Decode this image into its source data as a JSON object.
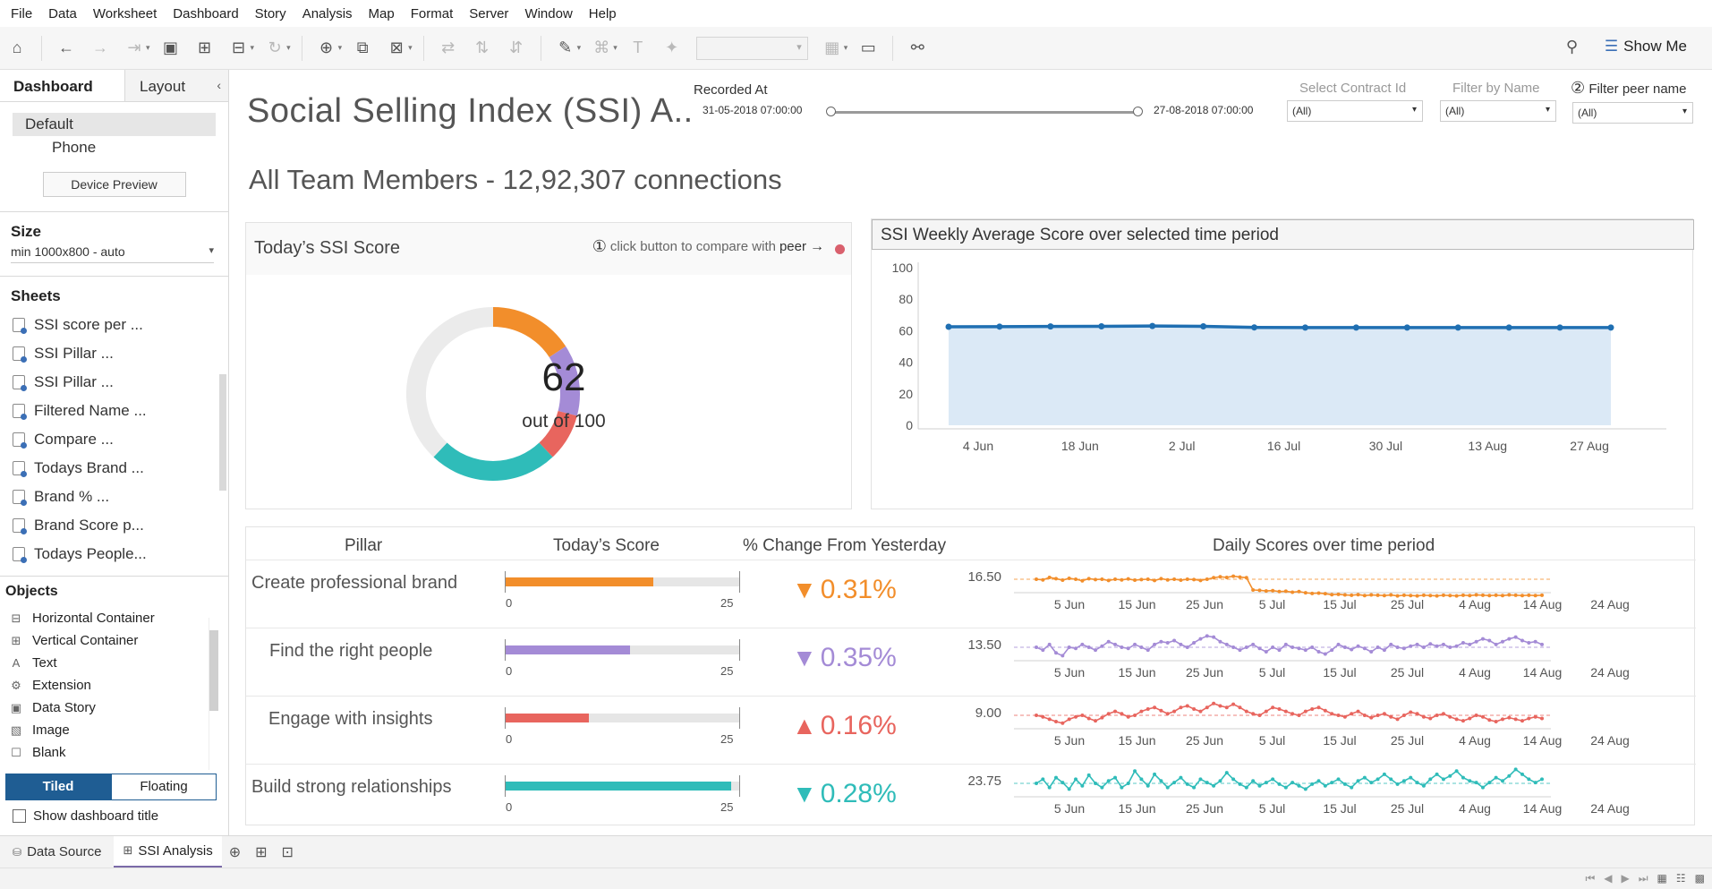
{
  "menu": [
    "File",
    "Data",
    "Worksheet",
    "Dashboard",
    "Story",
    "Analysis",
    "Map",
    "Format",
    "Server",
    "Window",
    "Help"
  ],
  "toolbar": {
    "show_me": "Show Me"
  },
  "left_panel": {
    "tab_dashboard": "Dashboard",
    "tab_layout": "Layout",
    "devices": [
      "Default",
      "Phone"
    ],
    "device_preview": "Device Preview",
    "size_title": "Size",
    "size_value": "min 1000x800 - auto",
    "sheets_title": "Sheets",
    "sheets": [
      "SSI score per ...",
      "SSI Pillar ...",
      "SSI Pillar ...",
      "Filtered Name ...",
      "Compare ...",
      "Todays Brand ...",
      "Brand % ...",
      "Brand Score p...",
      "Todays People..."
    ],
    "objects_title": "Objects",
    "objects": [
      {
        "label": "Horizontal Container",
        "icon": "horizontal-container-icon"
      },
      {
        "label": "Vertical Container",
        "icon": "vertical-container-icon"
      },
      {
        "label": "Text",
        "icon": "text-icon"
      },
      {
        "label": "Extension",
        "icon": "extension-icon"
      },
      {
        "label": "Data Story",
        "icon": "data-story-icon"
      },
      {
        "label": "Image",
        "icon": "image-icon"
      },
      {
        "label": "Blank",
        "icon": "blank-icon"
      }
    ],
    "tiled": "Tiled",
    "floating": "Floating",
    "show_dashboard_title": "Show dashboard title"
  },
  "dashboard": {
    "title": "Social Selling Index (SSI) A..",
    "subtitle": "All Team Members - 12,92,307 connections",
    "recorded_at": {
      "label": "Recorded At",
      "start": "31-05-2018 07:00:00",
      "end": "27-08-2018 07:00:00"
    },
    "filters": [
      {
        "label": "Select Contract Id",
        "value": "(All)"
      },
      {
        "label": "Filter by Name",
        "value": "(All)"
      },
      {
        "label": "Filter peer name",
        "value": "(All)",
        "marker": "②"
      }
    ],
    "ssi_card": {
      "title": "Today’s SSI Score",
      "compare_marker": "①",
      "compare_text": "click button to compare with",
      "compare_bold": "peer",
      "score": "62",
      "score_sub": "out of 100"
    },
    "weekly_title": "SSI Weekly Average Score over selected time period",
    "pillar_headers": {
      "pillar": "Pillar",
      "today": "Today’s Score",
      "change": "% Change From Yesterday",
      "daily": "Daily Scores over time period"
    },
    "pillars": [
      {
        "name": "Create professional brand",
        "value": 15.8,
        "max": 25,
        "change": "0.31%",
        "direction": "down",
        "color": "#f28e2b",
        "ref": "16.50",
        "min_label": "0",
        "max_label": "25"
      },
      {
        "name": "Find the right people",
        "value": 13.3,
        "max": 25,
        "change": "0.35%",
        "direction": "down",
        "color": "#a48bd6",
        "ref": "13.50",
        "min_label": "0",
        "max_label": "25"
      },
      {
        "name": "Engage with insights",
        "value": 8.9,
        "max": 25,
        "change": "0.16%",
        "direction": "up",
        "color": "#e8655e",
        "ref": "9.00",
        "min_label": "0",
        "max_label": "25"
      },
      {
        "name": "Build strong relationships",
        "value": 24.1,
        "max": 25,
        "change": "0.28%",
        "direction": "down",
        "color": "#2fbcb9",
        "ref": "23.75",
        "min_label": "0",
        "max_label": "25"
      }
    ],
    "spark_dates": [
      "5 Jun",
      "15 Jun",
      "25 Jun",
      "5 Jul",
      "15 Jul",
      "25 Jul",
      "4 Aug",
      "14 Aug",
      "24 Aug"
    ]
  },
  "chart_data": [
    {
      "type": "pie",
      "title": "Today’s SSI Score",
      "values": [
        15.8,
        13.3,
        8.9,
        24.1,
        38
      ],
      "colors": [
        "#f28e2b",
        "#a48bd6",
        "#e8655e",
        "#2fbcb9",
        "#ebebeb"
      ]
    },
    {
      "type": "area",
      "title": "SSI Weekly Average Score over selected time period",
      "x": [
        "2018-05-31",
        "2018-06-07",
        "2018-06-14",
        "2018-06-21",
        "2018-06-28",
        "2018-07-05",
        "2018-07-12",
        "2018-07-19",
        "2018-07-26",
        "2018-08-02",
        "2018-08-09",
        "2018-08-16",
        "2018-08-23",
        "2018-08-27"
      ],
      "values": [
        62.5,
        62.6,
        62.7,
        62.8,
        63.0,
        62.8,
        62.1,
        62.0,
        62.0,
        62.0,
        62.0,
        62.0,
        62.0,
        62.0
      ],
      "xticks": [
        "4 Jun",
        "18 Jun",
        "2 Jul",
        "16 Jul",
        "30 Jul",
        "13 Aug",
        "27 Aug"
      ],
      "yticks": [
        "0",
        "20",
        "40",
        "60",
        "80",
        "100"
      ],
      "ylim": [
        0,
        100
      ],
      "color": "#1f6fb2"
    },
    {
      "type": "line",
      "title": "Create professional brand",
      "values": [
        16.5,
        16.48,
        16.56,
        16.52,
        16.47,
        16.53,
        16.5,
        16.45,
        16.52,
        16.49,
        16.5,
        16.46,
        16.5,
        16.48,
        16.51,
        16.47,
        16.49,
        16.5,
        16.46,
        16.52,
        16.48,
        16.5,
        16.47,
        16.5,
        16.49,
        16.46,
        16.5,
        16.55,
        16.58,
        16.56,
        16.6,
        16.57,
        16.55,
        16.15,
        16.14,
        16.12,
        16.13,
        16.1,
        16.11,
        16.08,
        16.1,
        16.06,
        16.04,
        16.05,
        16.03,
        16.0,
        16.01,
        15.99,
        15.98,
        16.0,
        15.97,
        15.99,
        15.98,
        15.97,
        15.99,
        15.96,
        15.98,
        15.97,
        15.96,
        15.98,
        15.97,
        15.96,
        15.98,
        15.97,
        15.96,
        15.98,
        15.97,
        15.99,
        15.98,
        15.97,
        15.98,
        15.97,
        15.99,
        15.98,
        15.97,
        15.98,
        15.97,
        15.98
      ],
      "color": "#f28e2b"
    },
    {
      "type": "line",
      "title": "Find the right people",
      "values": [
        13.5,
        13.45,
        13.55,
        13.4,
        13.35,
        13.5,
        13.48,
        13.55,
        13.5,
        13.45,
        13.52,
        13.6,
        13.55,
        13.5,
        13.48,
        13.55,
        13.5,
        13.45,
        13.55,
        13.6,
        13.58,
        13.62,
        13.55,
        13.5,
        13.58,
        13.65,
        13.7,
        13.68,
        13.6,
        13.55,
        13.5,
        13.45,
        13.5,
        13.55,
        13.48,
        13.42,
        13.5,
        13.45,
        13.55,
        13.5,
        13.48,
        13.45,
        13.5,
        13.42,
        13.38,
        13.45,
        13.55,
        13.5,
        13.46,
        13.52,
        13.48,
        13.42,
        13.5,
        13.45,
        13.55,
        13.5,
        13.48,
        13.52,
        13.55,
        13.5,
        13.56,
        13.52,
        13.55,
        13.5,
        13.52,
        13.58,
        13.55,
        13.6,
        13.65,
        13.62,
        13.55,
        13.6,
        13.65,
        13.68,
        13.62,
        13.58,
        13.6,
        13.55
      ],
      "color": "#a48bd6"
    },
    {
      "type": "line",
      "title": "Engage with insights",
      "values": [
        9.0,
        8.98,
        8.95,
        8.92,
        8.9,
        8.95,
        8.98,
        9.0,
        8.96,
        8.93,
        8.97,
        9.02,
        9.05,
        9.02,
        8.98,
        9.0,
        9.05,
        9.08,
        9.1,
        9.06,
        9.02,
        9.05,
        9.1,
        9.12,
        9.08,
        9.05,
        9.1,
        9.15,
        9.12,
        9.1,
        9.14,
        9.1,
        9.05,
        9.02,
        9.0,
        9.05,
        9.1,
        9.08,
        9.05,
        9.02,
        9.0,
        9.05,
        9.08,
        9.1,
        9.06,
        9.02,
        9.0,
        8.98,
        9.02,
        9.05,
        9.0,
        8.97,
        9.0,
        9.02,
        8.98,
        8.95,
        9.0,
        9.04,
        9.02,
        8.98,
        8.96,
        9.0,
        9.02,
        8.98,
        8.95,
        8.93,
        8.96,
        9.0,
        8.98,
        8.94,
        8.92,
        8.95,
        8.97,
        8.95,
        8.93,
        8.96,
        8.98,
        8.96
      ],
      "color": "#e8655e"
    },
    {
      "type": "line",
      "title": "Build strong relationships",
      "values": [
        23.75,
        23.8,
        23.7,
        23.82,
        23.76,
        23.68,
        23.8,
        23.72,
        23.85,
        23.75,
        23.7,
        23.78,
        23.82,
        23.7,
        23.75,
        23.9,
        23.8,
        23.72,
        23.86,
        23.78,
        23.7,
        23.76,
        23.82,
        23.74,
        23.7,
        23.8,
        23.76,
        23.72,
        23.78,
        23.88,
        23.8,
        23.74,
        23.7,
        23.78,
        23.72,
        23.76,
        23.8,
        23.74,
        23.7,
        23.76,
        23.72,
        23.68,
        23.74,
        23.78,
        23.72,
        23.76,
        23.8,
        23.74,
        23.7,
        23.78,
        23.82,
        23.76,
        23.8,
        23.86,
        23.8,
        23.74,
        23.78,
        23.82,
        23.76,
        23.72,
        23.8,
        23.86,
        23.8,
        23.84,
        23.9,
        23.82,
        23.78,
        23.76,
        23.7,
        23.76,
        23.82,
        23.78,
        23.84,
        23.92,
        23.86,
        23.8,
        23.76,
        23.8
      ],
      "color": "#2fbcb9"
    }
  ]
}
